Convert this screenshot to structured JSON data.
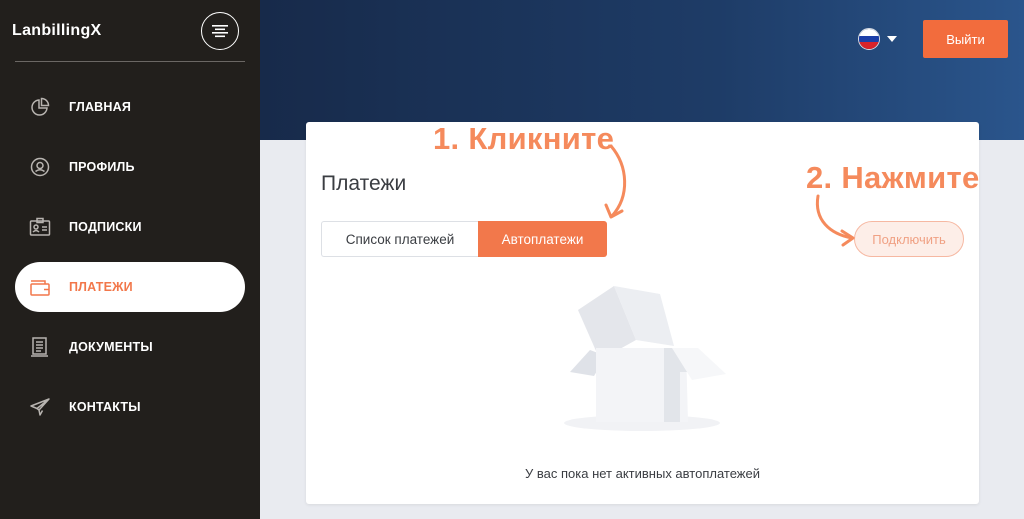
{
  "brand": "LanbillingX",
  "sidebar": {
    "items": [
      {
        "label": "ГЛАВНАЯ",
        "icon": "pie-chart-icon"
      },
      {
        "label": "ПРОФИЛЬ",
        "icon": "user-circle-icon"
      },
      {
        "label": "ПОДПИСКИ",
        "icon": "id-card-icon"
      },
      {
        "label": "ПЛАТЕЖИ",
        "icon": "wallet-icon",
        "active": true
      },
      {
        "label": "ДОКУМЕНТЫ",
        "icon": "document-icon"
      },
      {
        "label": "КОНТАКТЫ",
        "icon": "paper-plane-icon"
      }
    ]
  },
  "header": {
    "language_icon": "russian-flag-icon",
    "logout_label": "Выйти"
  },
  "main": {
    "title": "Платежи",
    "tabs": [
      {
        "label": "Список платежей",
        "active": false
      },
      {
        "label": "Автоплатежи",
        "active": true
      }
    ],
    "connect_label": "Подключить",
    "empty_state_text": "У вас пока нет активных автоплатежей",
    "empty_state_icon": "empty-box-icon"
  },
  "annotations": {
    "step1": "1. Кликните",
    "step2": "2. Нажмите"
  },
  "colors": {
    "accent": "#f2784b",
    "sidebar_bg": "#221f1c",
    "header_start": "#172a4a",
    "header_end": "#2a558c",
    "annotation": "#f58a5c"
  }
}
